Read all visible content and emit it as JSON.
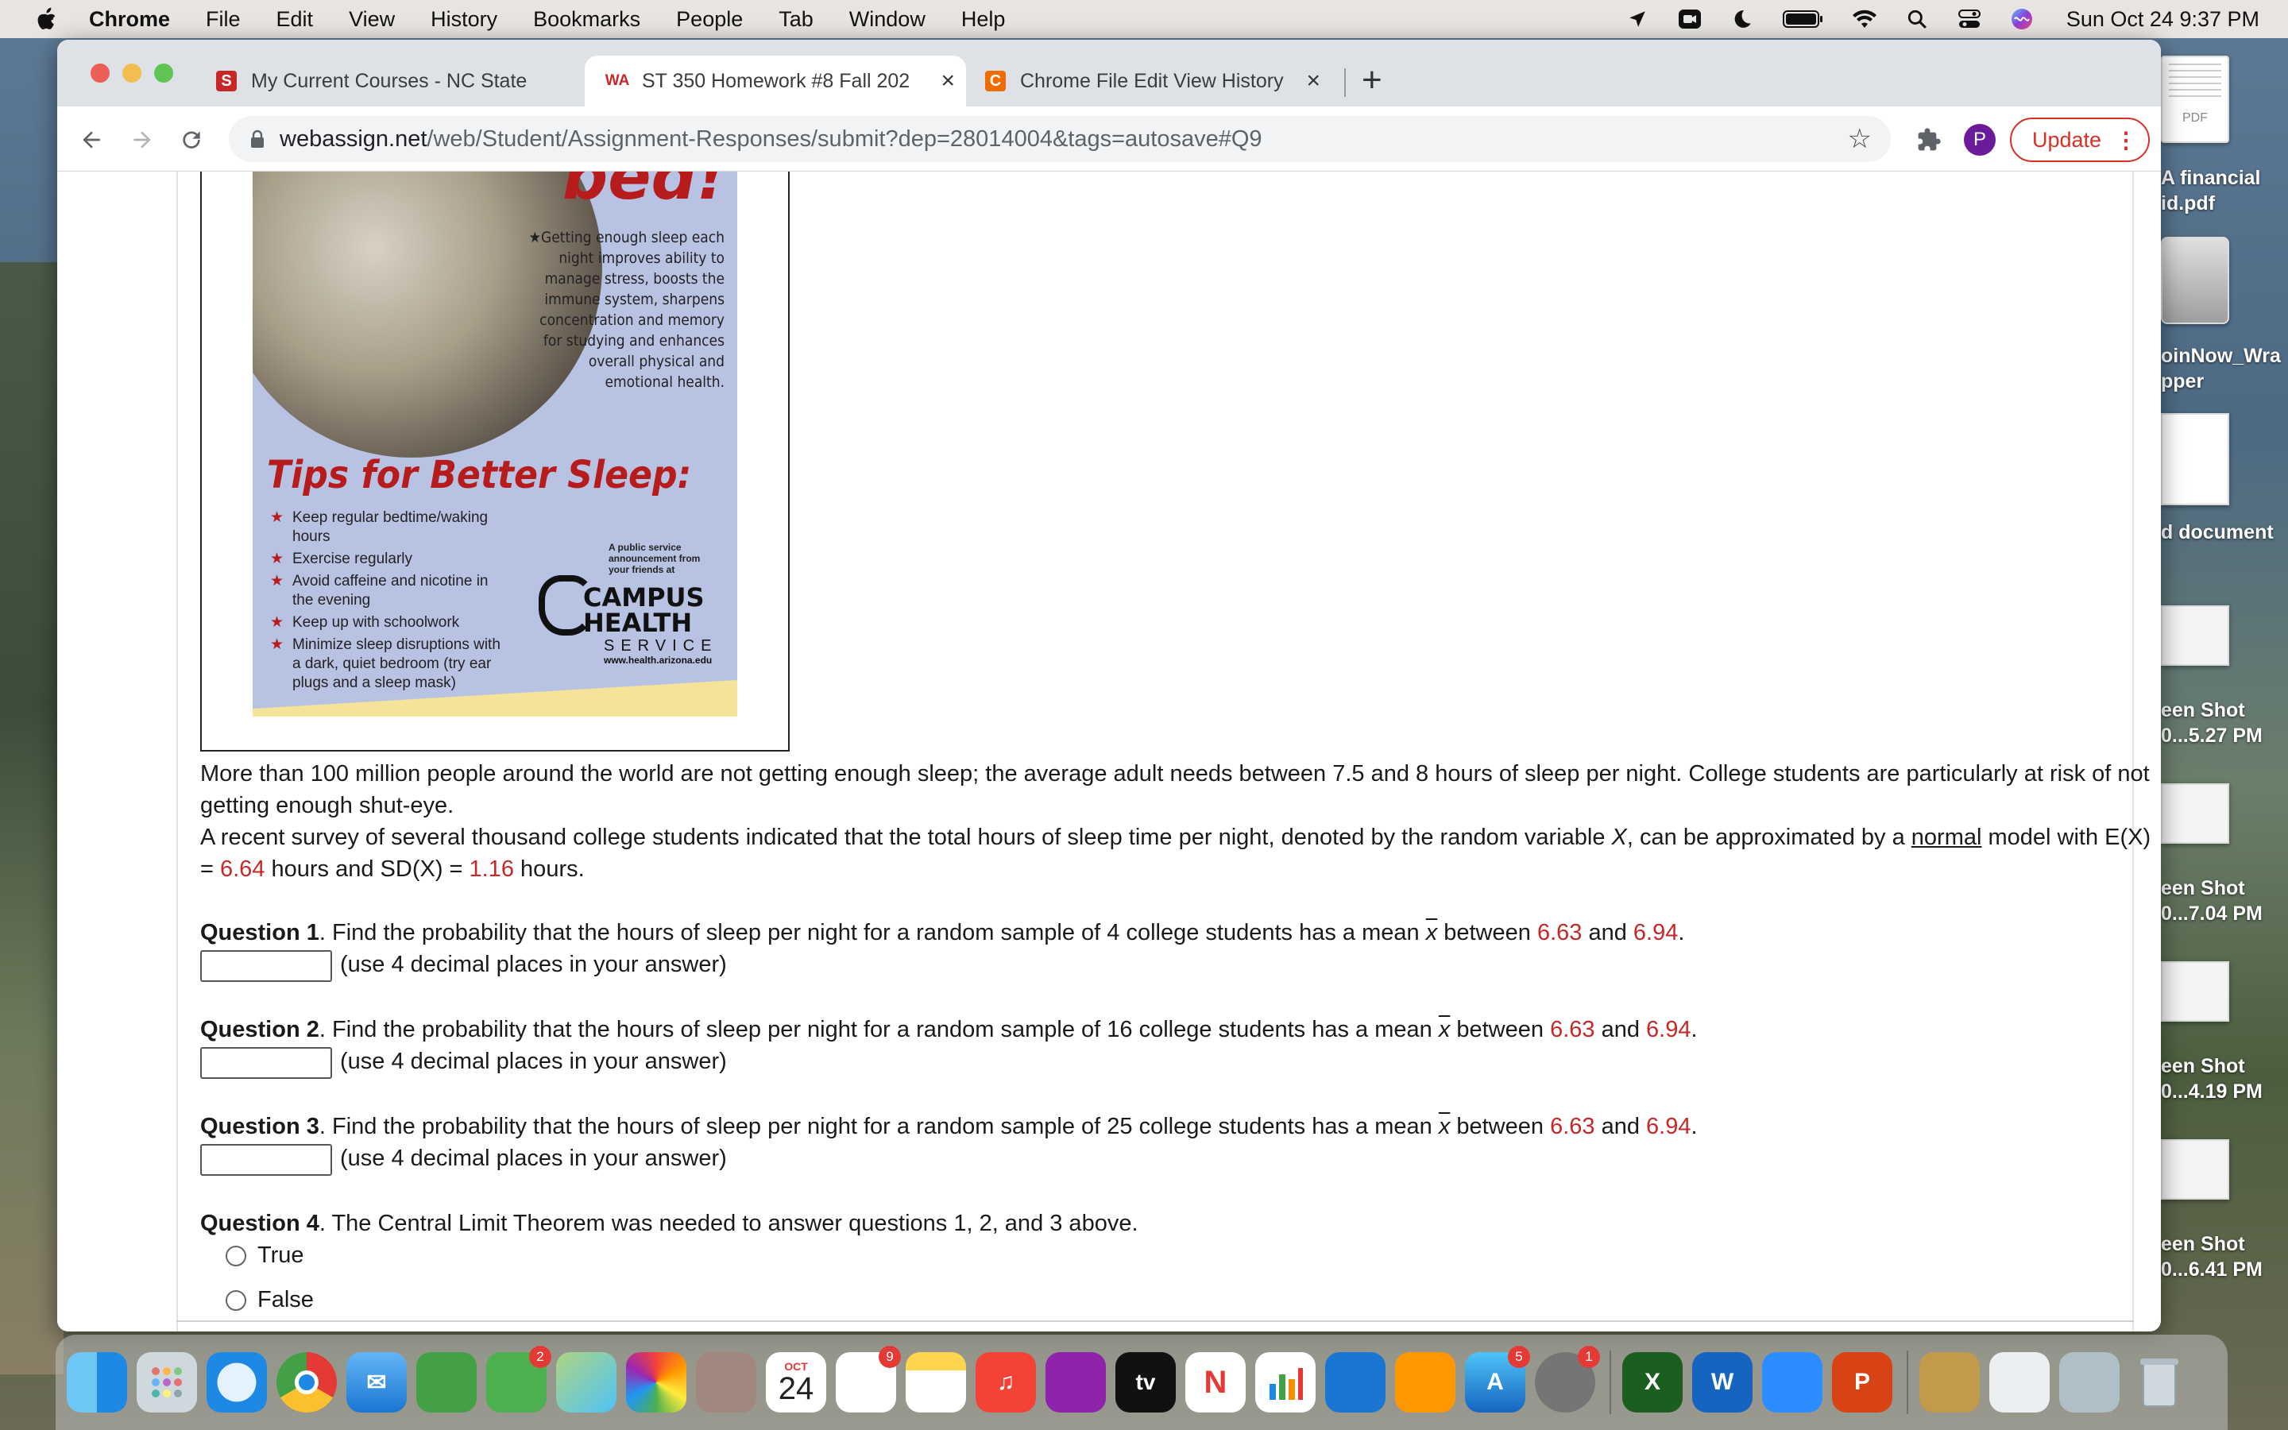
{
  "menubar": {
    "app": "Chrome",
    "items": [
      "File",
      "Edit",
      "View",
      "History",
      "Bookmarks",
      "People",
      "Tab",
      "Window",
      "Help"
    ],
    "clock": "Sun Oct 24  9:37 PM"
  },
  "tabs": [
    {
      "title": "My Current Courses - NC State",
      "favicon": "S",
      "active": false
    },
    {
      "title": "ST 350 Homework #8 Fall 202",
      "favicon": "WA",
      "active": true
    },
    {
      "title": "Chrome File Edit View History B",
      "favicon": "C",
      "active": false
    }
  ],
  "toolbar": {
    "url_host": "webassign.net",
    "url_path": "/web/Student/Assignment-Responses/submit?dep=28014004&tags=autosave#Q9",
    "avatar_letter": "P",
    "update_label": "Update"
  },
  "poster": {
    "title_fragment": "bed!",
    "blurb": "★Getting enough sleep each night improves ability to manage stress, boosts the immune system, sharpens concentration and memory for studying and enhances overall physical and emotional health.",
    "tips_heading": "Tips for Better Sleep:",
    "tips": [
      "Keep regular bedtime/waking hours",
      "Exercise regularly",
      "Avoid caffeine and nicotine in the evening",
      "Keep up with schoolwork",
      "Minimize sleep disruptions with a dark, quiet bedroom (try ear plugs and a sleep mask)"
    ],
    "psa": "A public service announcement from your friends at",
    "org1": "CAMPUS",
    "org2": "HEALTH",
    "org3": "SERVICE",
    "url": "www.health.arizona.edu"
  },
  "problem": {
    "intro1": "More than 100 million people around the world are not getting enough sleep; the average adult needs between 7.5 and 8 hours of sleep per night. College students are particularly at risk of not getting enough shut-eye.",
    "intro2a": "A recent survey of several thousand college students indicated that the total hours of sleep time per night, denoted by the random variable ",
    "var": "X",
    "intro2b": ", can be approximated by a ",
    "normal_link": "normal",
    "intro2c": " model with E(X) = ",
    "mean": "6.64",
    "intro2d": " hours and SD(X) = ",
    "sd": "1.16",
    "intro2e": " hours.",
    "questions": [
      {
        "label": "Question 1",
        "text": ". Find the probability that the hours of sleep per night for a random sample of 4 college students has a mean ",
        "low": "6.63",
        "high": "6.94",
        "hint": "(use 4 decimal places in your answer)"
      },
      {
        "label": "Question 2",
        "text": ". Find the probability that the hours of sleep per night for a random sample of 16 college students has a mean ",
        "low": "6.63",
        "high": "6.94",
        "hint": "(use 4 decimal places in your answer)"
      },
      {
        "label": "Question 3",
        "text": ". Find the probability that the hours of sleep per night for a random sample of 25 college students has a mean ",
        "low": "6.63",
        "high": "6.94",
        "hint": "(use 4 decimal places in your answer)"
      }
    ],
    "q4_label": "Question 4",
    "q4_text": ". The Central Limit Theorem was needed to answer questions 1, 2, and 3 above.",
    "q4_options": [
      "True",
      "False"
    ],
    "xbar": "x",
    "between": " between ",
    "and": " and ",
    "period": "."
  },
  "desktop": [
    {
      "label1": "A financial",
      "label2": "id.pdf",
      "kind": "PDF"
    },
    {
      "label1": "oinNow_Wra",
      "label2": "pper"
    },
    {
      "label1": "d document",
      "label2": ""
    },
    {
      "label1": "een Shot",
      "label2": "0...5.27 PM"
    },
    {
      "label1": "een Shot",
      "label2": "0...7.04 PM"
    },
    {
      "label1": "een Shot",
      "label2": "0...4.19 PM"
    },
    {
      "label1": "een Shot",
      "label2": "0...6.41 PM"
    }
  ],
  "dock": {
    "calendar_month": "OCT",
    "calendar_day": "24",
    "messages_badge": "2",
    "reminders_badge": "9",
    "appstore_badge": "5",
    "settings_badge": "1",
    "tv_label": "tv"
  }
}
